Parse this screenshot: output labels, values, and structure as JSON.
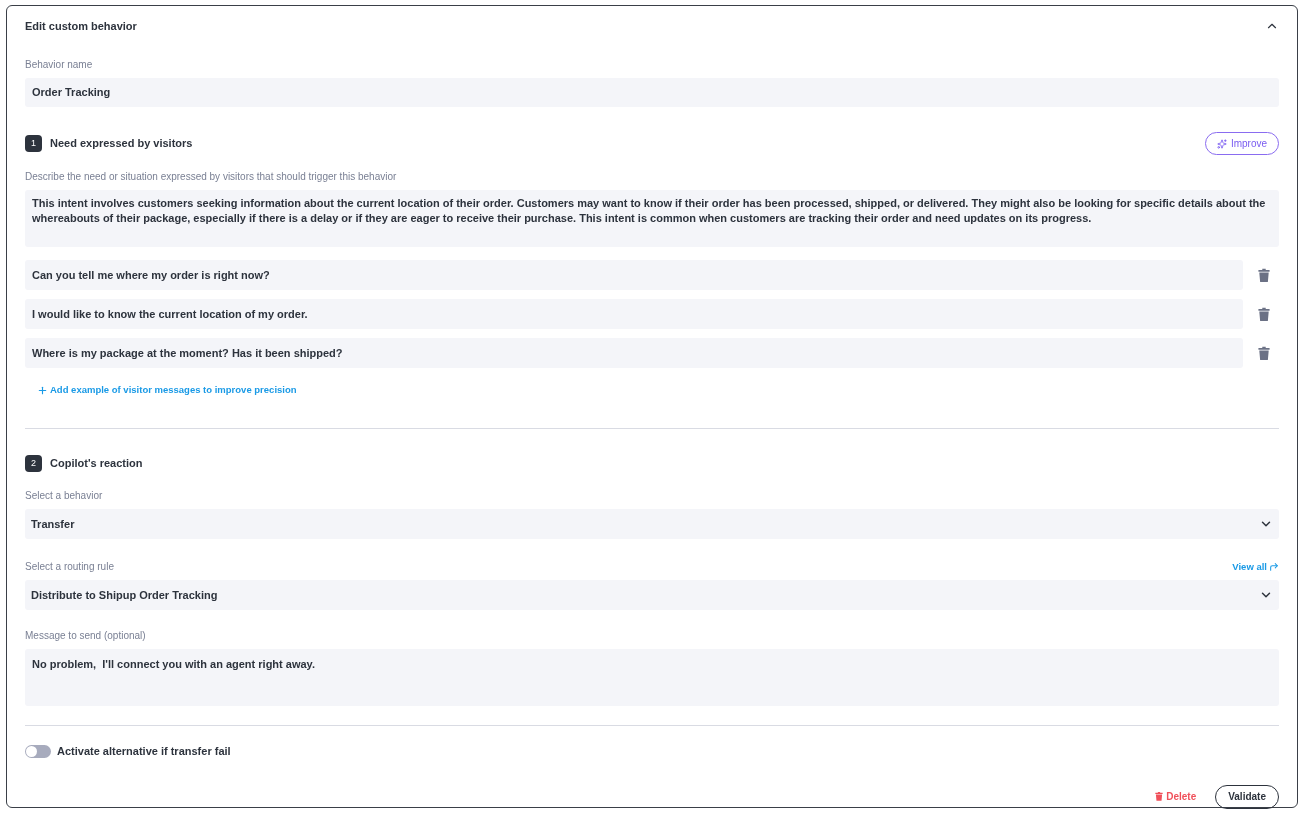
{
  "panel": {
    "title": "Edit custom behavior",
    "expanded": true
  },
  "behavior_name": {
    "label": "Behavior name",
    "value": "Order Tracking"
  },
  "need_section": {
    "number": "1",
    "title": "Need expressed by visitors",
    "improve_button": "Improve",
    "description_label": "Describe the need or situation expressed by visitors that should trigger this behavior",
    "description": "This intent involves customers seeking information about the current location of their order. Customers may want to know if their order has been processed, shipped, or delivered. They might also be looking for specific details about the whereabouts of their package, especially if there is a delay or if they are eager to receive their purchase. This intent is common when customers are tracking their order and need updates on its progress.",
    "examples": [
      {
        "value": "Can you tell me where my order is right now?"
      },
      {
        "value": "I would like to know the current location of my order."
      },
      {
        "value": "Where is my package at the moment? Has it been shipped?"
      }
    ],
    "add_link": "Add example of visitor messages to improve precision"
  },
  "reaction_section": {
    "number": "2",
    "title": "Copilot's reaction",
    "behavior_label": "Select a behavior",
    "behavior_value": "Transfer",
    "routing_label": "Select a routing rule",
    "view_all_link": "View all",
    "routing_value": "Distribute to Shipup Order Tracking",
    "message_label": "Message to send (optional)",
    "message_value": "No problem,  I'll connect you with an agent right away."
  },
  "alternative_toggle": {
    "label": "Activate alternative if transfer fail",
    "on": false
  },
  "footer": {
    "delete_button": "Delete",
    "validate_button": "Validate"
  }
}
